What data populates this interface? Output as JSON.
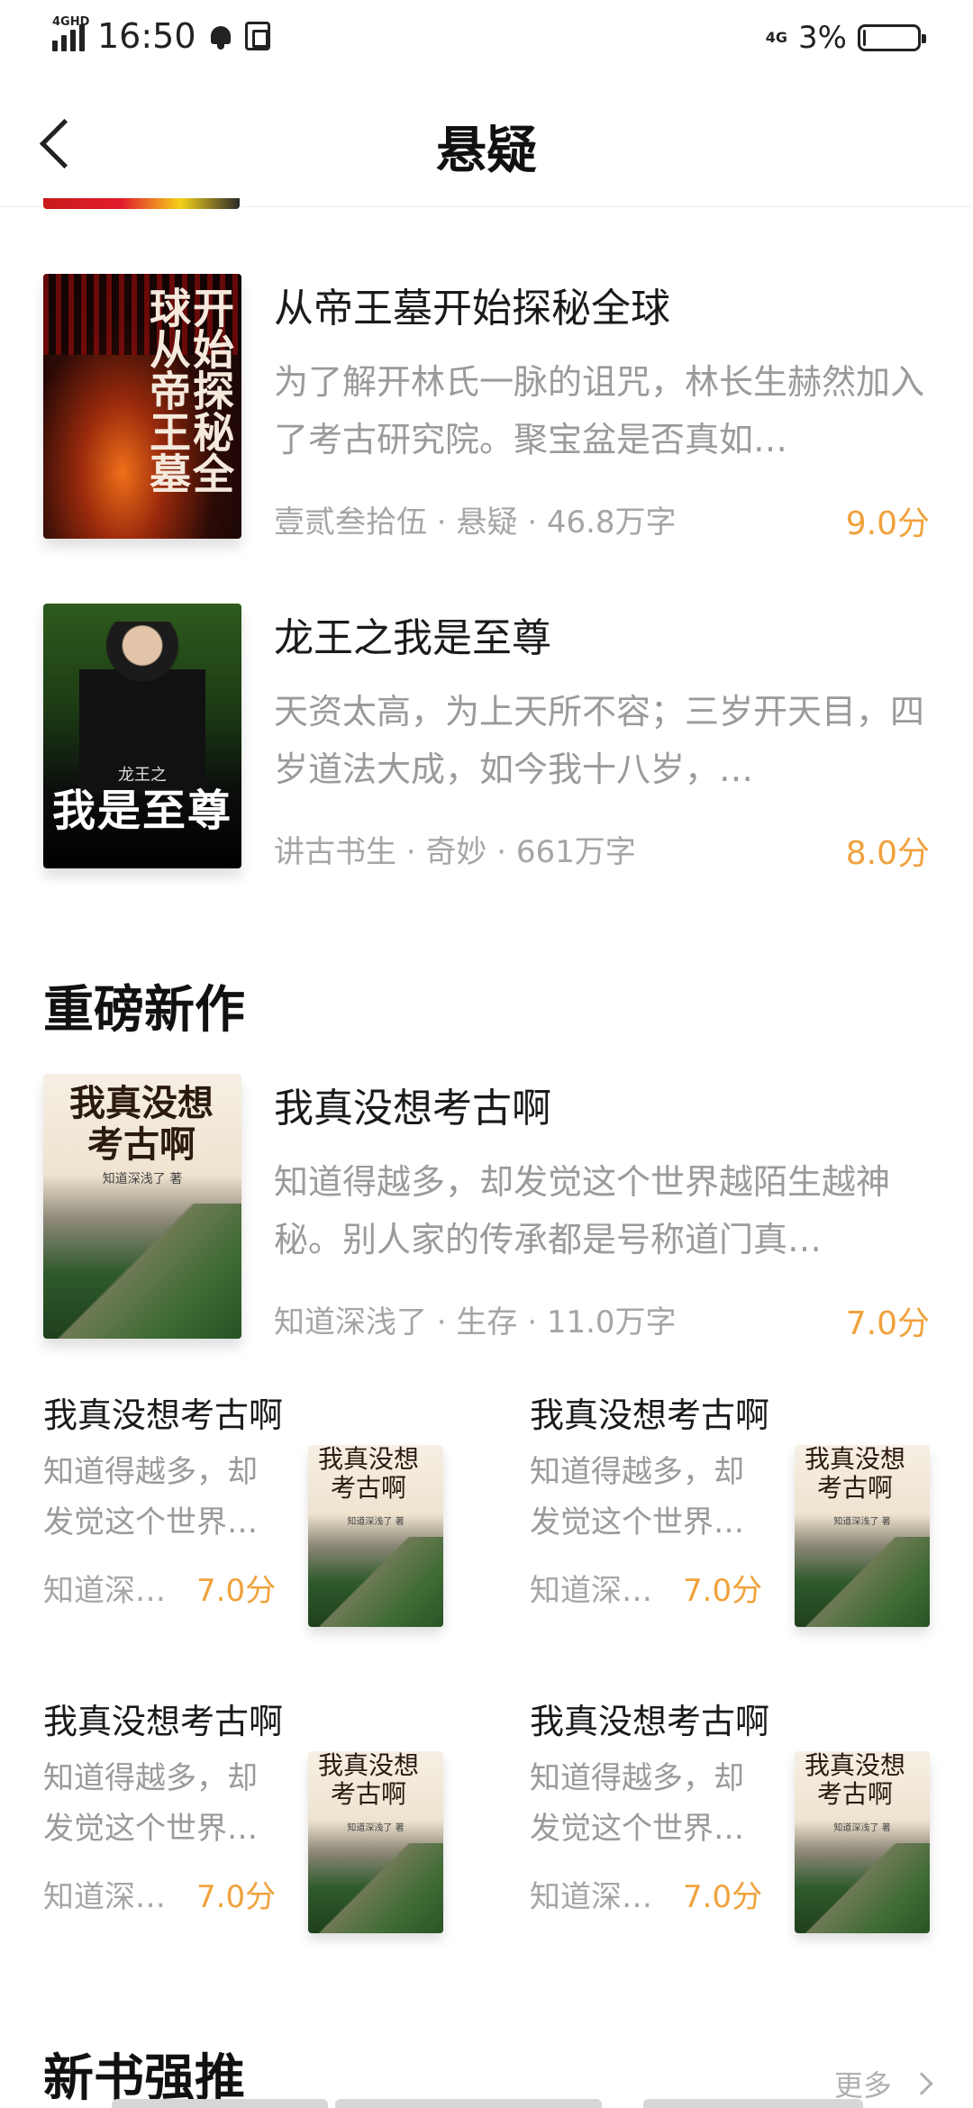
{
  "status_bar": {
    "network_label": "4GHD",
    "time": "16:50",
    "net_type": "4G",
    "battery_pct": "3%"
  },
  "header": {
    "title": "悬疑"
  },
  "list_items": [
    {
      "title": "从帝王墓开始探秘全球",
      "desc": "为了解开林氏一脉的诅咒，林长生赫然加入了考古研究院。聚宝盆是否真如…",
      "meta": "壹贰叁拾伍 · 悬疑 · 46.8万字",
      "score": "9.0分",
      "cover_text": "开始探秘全球从帝王墓"
    },
    {
      "title": "龙王之我是至尊",
      "desc": "天资太高，为上天所不容；三岁开天目，四岁道法大成，如今我十八岁，…",
      "meta": "讲古书生 · 奇妙 · 661万字",
      "score": "8.0分",
      "cover_text": "我是至尊",
      "cover_sub": "龙王之"
    }
  ],
  "sections": {
    "new_works": "重磅新作",
    "new_books": "新书强推",
    "more": "更多"
  },
  "feature": {
    "title": "我真没想考古啊",
    "desc": "知道得越多，却发觉这个世界越陌生越神秘。别人家的传承都是号称道门真…",
    "meta": "知道深浅了 · 生存 · 11.0万字",
    "score": "7.0分",
    "cover_text": "我真没想考古啊",
    "cover_author": "知道深浅了 著"
  },
  "grid": [
    {
      "title": "我真没想考古啊",
      "desc": "知道得越多，却发觉这个世界…",
      "author": "知道深…",
      "score": "7.0分",
      "cover_text": "我真没想考古啊",
      "cover_author": "知道深浅了 著"
    },
    {
      "title": "我真没想考古啊",
      "desc": "知道得越多，却发觉这个世界…",
      "author": "知道深…",
      "score": "7.0分",
      "cover_text": "我真没想考古啊",
      "cover_author": "知道深浅了 著"
    },
    {
      "title": "我真没想考古啊",
      "desc": "知道得越多，却发觉这个世界…",
      "author": "知道深…",
      "score": "7.0分",
      "cover_text": "我真没想考古啊",
      "cover_author": "知道深浅了 著"
    },
    {
      "title": "我真没想考古啊",
      "desc": "知道得越多，却发觉这个世界…",
      "author": "知道深…",
      "score": "7.0分",
      "cover_text": "我真没想考古啊",
      "cover_author": "知道深浅了 著"
    }
  ],
  "colors": {
    "score": "#f0a23c",
    "muted": "#9a9a9a",
    "title": "#1a1a1a"
  }
}
